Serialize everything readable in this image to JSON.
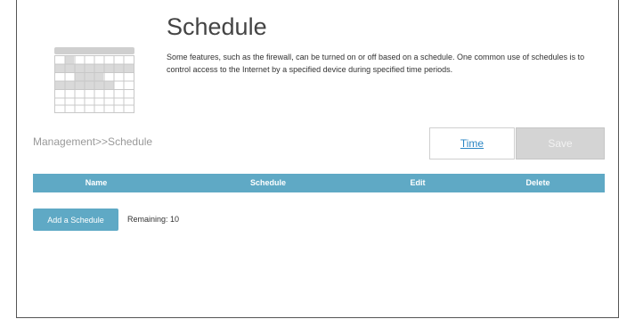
{
  "page": {
    "title": "Schedule",
    "description": "Some features, such as the firewall, can be turned on or off based on a schedule. One common use of schedules is to control access to the Internet by a specified device during specified time periods.",
    "breadcrumb": "Management>>Schedule",
    "icon": "calendar-icon"
  },
  "actions": {
    "time_label": "Time",
    "save_label": "Save"
  },
  "table": {
    "columns": [
      "Name",
      "Schedule",
      "Edit",
      "Delete"
    ],
    "rows": []
  },
  "footer": {
    "add_label": "Add a Schedule",
    "remaining": "Remaining: 10"
  },
  "colors": {
    "accent": "#5fa9c5",
    "link": "#2a86c4",
    "disabled_button": "#d4d4d4"
  }
}
